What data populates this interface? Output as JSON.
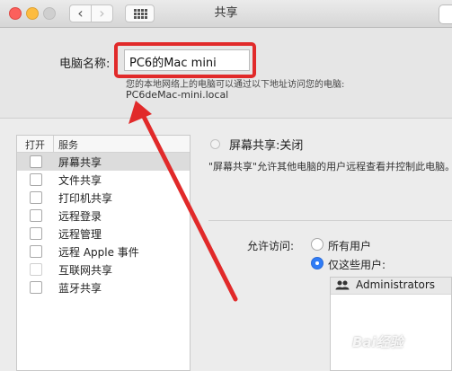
{
  "window": {
    "title": "共享"
  },
  "toolbar": {
    "back_glyph": "‹",
    "forward_glyph": "›",
    "grid_icon": "grid-icon"
  },
  "computer_name": {
    "label": "电脑名称:",
    "value": "PC6的Mac mini",
    "access_hint": "您的本地网络上的电脑可以通过以下地址访问您的电脑:",
    "hostname": "PC6deMac-mini.local"
  },
  "services": {
    "header_on": "打开",
    "header_service": "服务",
    "items": [
      {
        "label": "屏幕共享",
        "selected": true,
        "checked": false
      },
      {
        "label": "文件共享",
        "selected": false,
        "checked": false
      },
      {
        "label": "打印机共享",
        "selected": false,
        "checked": false
      },
      {
        "label": "远程登录",
        "selected": false,
        "checked": false
      },
      {
        "label": "远程管理",
        "selected": false,
        "checked": false
      },
      {
        "label": "远程 Apple 事件",
        "selected": false,
        "checked": false
      },
      {
        "label": "互联网共享",
        "selected": false,
        "checked": false
      },
      {
        "label": "蓝牙共享",
        "selected": false,
        "checked": false
      }
    ]
  },
  "detail": {
    "status": "屏幕共享:关闭",
    "description": "\"屏幕共享\"允许其他电脑的用户远程查看并控制此电脑。",
    "allow_label": "允许访问:",
    "option_all": "所有用户",
    "option_these": "仅这些用户:",
    "selected_option": "option_these",
    "users": [
      {
        "name": "Administrators",
        "icon": "group-icon"
      }
    ]
  },
  "annotation": {
    "color": "#e12a2a"
  },
  "watermark": "Bai经验"
}
